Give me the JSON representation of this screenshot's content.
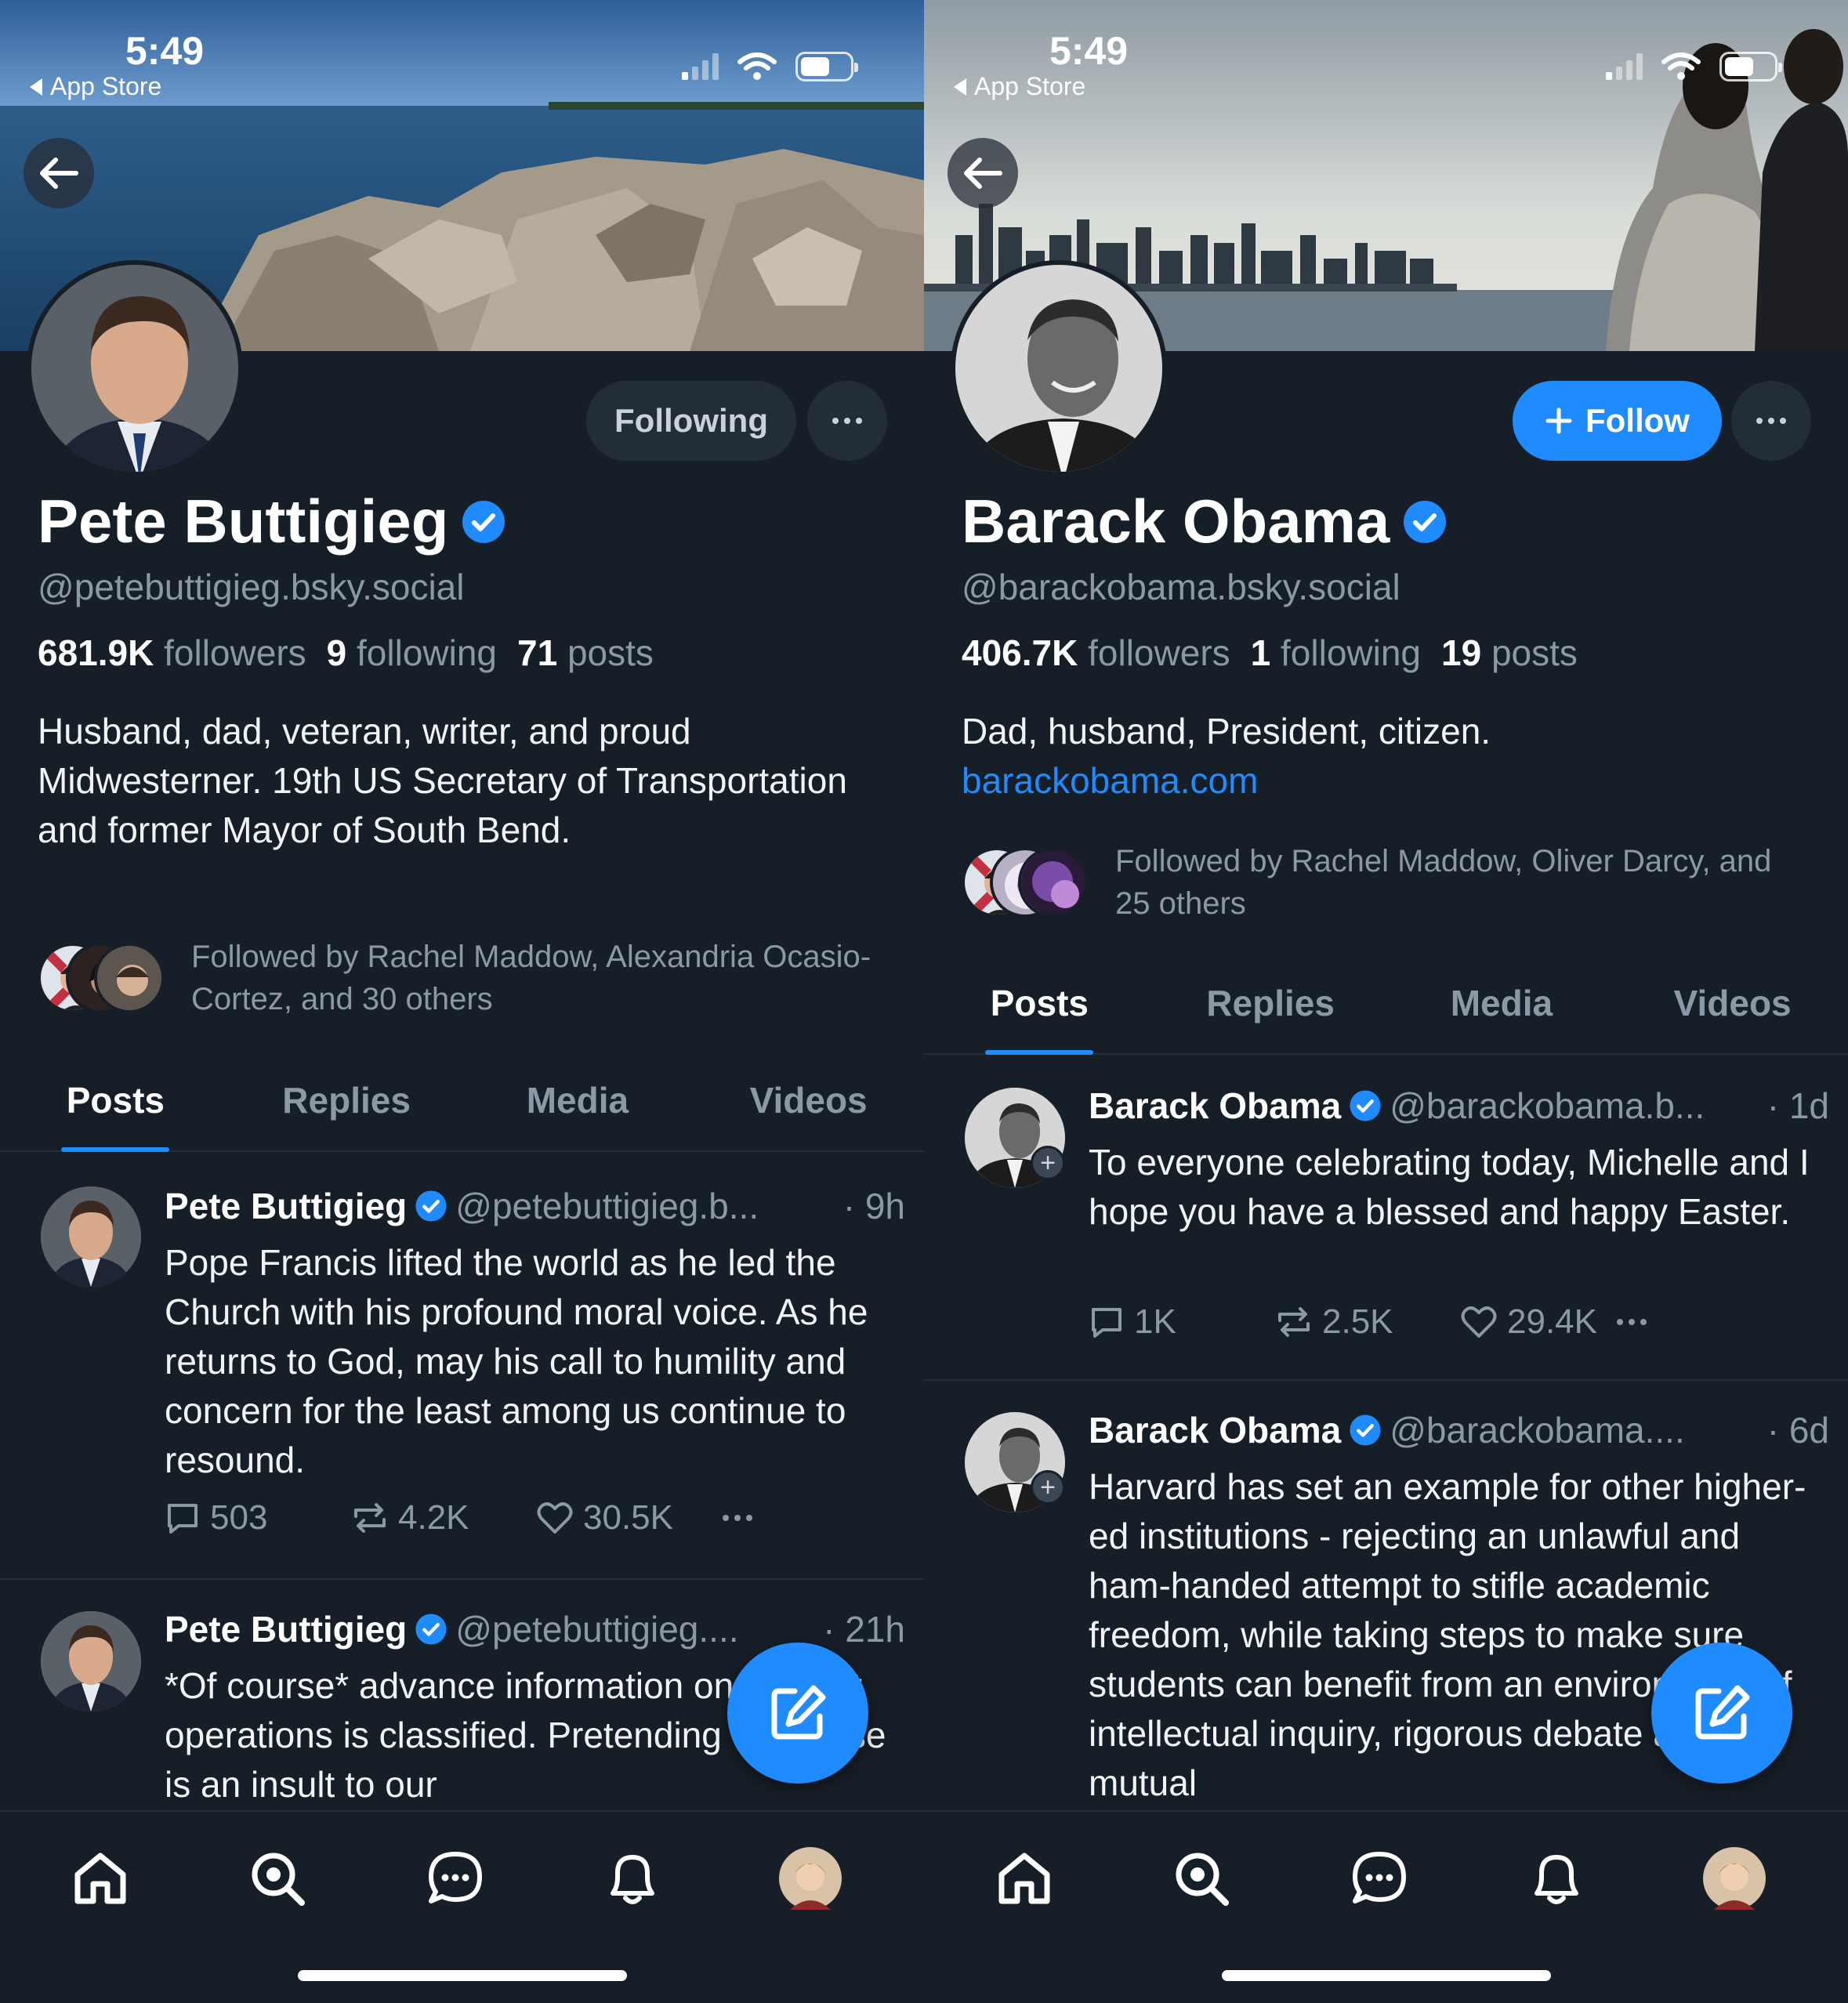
{
  "status_bar": {
    "time": "5:49",
    "back_app": "App Store"
  },
  "profiles": [
    {
      "name": "Pete Buttigieg",
      "handle": "@petebuttigieg.bsky.social",
      "relation_button": "Following",
      "stats": {
        "followers": "681.9K",
        "followers_label": "followers",
        "following": "9",
        "following_label": "following",
        "posts": "71",
        "posts_label": "posts"
      },
      "bio": "Husband, dad, veteran, writer, and proud Midwesterner. 19th US Secretary of Transportation and former Mayor of South Bend.",
      "followed_by": "Followed by Rachel Maddow, Alexandria Ocasio-Cortez, and 30 others",
      "tabs": [
        "Posts",
        "Replies",
        "Media",
        "Videos"
      ],
      "posts": [
        {
          "name": "Pete Buttigieg",
          "handle": "@petebuttigieg.b...",
          "time": "· 9h",
          "text": "Pope Francis lifted the world as he led the Church with his profound moral voice. As he returns to God, may his call to humility and concern for the least among us continue to resound.",
          "replies": "503",
          "reposts": "4.2K",
          "likes": "30.5K"
        },
        {
          "name": "Pete Buttigieg",
          "handle": "@petebuttigieg....",
          "time": "· 21h",
          "text": "*Of course* advance information on combat operations is classified. Pretending otherwise is an insult to our"
        }
      ]
    },
    {
      "name": "Barack Obama",
      "handle": "@barackobama.bsky.social",
      "relation_button": "Follow",
      "stats": {
        "followers": "406.7K",
        "followers_label": "followers",
        "following": "1",
        "following_label": "following",
        "posts": "19",
        "posts_label": "posts"
      },
      "bio": "Dad, husband, President, citizen.",
      "link": "barackobama.com",
      "followed_by": "Followed by Rachel Maddow, Oliver Darcy, and 25 others",
      "tabs": [
        "Posts",
        "Replies",
        "Media",
        "Videos"
      ],
      "posts": [
        {
          "name": "Barack Obama",
          "handle": "@barackobama.b...",
          "time": "· 1d",
          "text": "To everyone celebrating today, Michelle and I hope you have a blessed and happy Easter.",
          "replies": "1K",
          "reposts": "2.5K",
          "likes": "29.4K"
        },
        {
          "name": "Barack Obama",
          "handle": "@barackobama....",
          "time": "· 6d",
          "text": "Harvard has set an example for other higher-ed institutions - rejecting an unlawful and ham-handed attempt to stifle academic freedom, while taking steps to make sure students can benefit from an environment of intellectual inquiry, rigorous debate and mutual"
        }
      ]
    }
  ],
  "bottom_nav": [
    "home-icon",
    "search-icon",
    "chat-icon",
    "bell-icon",
    "profile-avatar"
  ],
  "colors": {
    "background": "#161e27",
    "accent": "#208bfe",
    "muted": "#8b98a5",
    "divider": "#26303b"
  }
}
